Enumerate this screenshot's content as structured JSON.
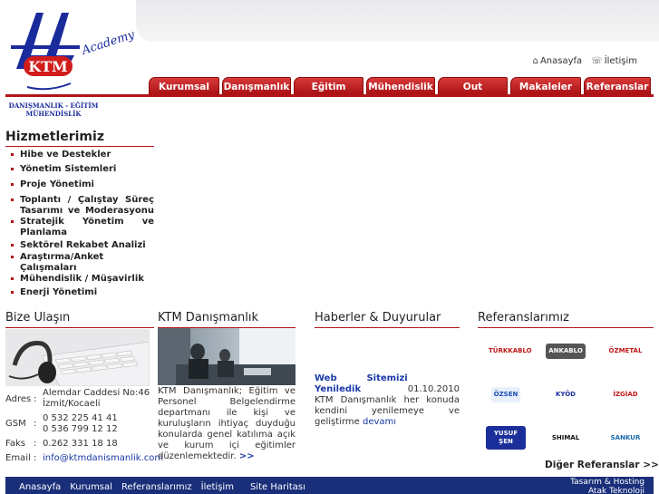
{
  "brand": {
    "letters": "KTM",
    "academy": "Academy",
    "subtitle_line1": "DANIŞMANLIK - EĞİTİM",
    "subtitle_line2": "MÜHENDİSLİK"
  },
  "toplinks": {
    "home": "Anasayfa",
    "contact": "İletişim"
  },
  "nav": [
    {
      "label": "Kurumsal",
      "w": 78
    },
    {
      "label": "Danışmanlık",
      "w": 76
    },
    {
      "label": "Eğitim",
      "w": 77
    },
    {
      "label": "Mühendislik",
      "w": 76
    },
    {
      "label": "Out Sourcing",
      "w": 77
    },
    {
      "label": "Makaleler",
      "w": 78
    },
    {
      "label": "Referanslar",
      "w": 74
    }
  ],
  "services": {
    "title": "Hizmetlerimiz",
    "items": [
      "Hibe ve Destekler",
      "Yönetim Sistemleri",
      "Proje Yönetimi",
      "Toplantı / Çalıştay Süreç Tasarımı ve Moderasyonu",
      "Stratejik Yönetim ve Planlama",
      "Sektörel Rekabet Analizi",
      "Araştırma/Anket Çalışmaları",
      "Mühendislik / Müşavirlik",
      "Enerji Yönetimi"
    ]
  },
  "contact": {
    "title": "Bize Ulaşın",
    "address_label": "Adres",
    "address": "Alemdar Caddesi No:46 İzmit/Kocaeli",
    "gsm_label": "GSM",
    "gsm1": "0 532 225 41 41",
    "gsm2": "0 536 799 12 12",
    "fax_label": "Faks",
    "fax": "0.262 331 18 18",
    "email_label": "Email",
    "email": "info@ktmdanismanlik.com"
  },
  "about": {
    "title": "KTM Danışmanlık",
    "text": "KTM Danışmanlık; Eğitim ve Personel Belgelendirme departmanı ile kişi ve kuruluşların ihtiyaç duyduğu konularda genel katılıma açık ve kurum içi eğitimler düzenlemektedir.",
    "more": ">>"
  },
  "news": {
    "title": "Haberler & Duyurular",
    "item_title": "Web Sitemizi Yeniledik",
    "item_date": "01.10.2010",
    "item_body": "KTM Danışmanlık her konuda kendini yenilemeye ve geliştirme",
    "item_more": "devamı"
  },
  "references": {
    "title": "Referanslarımız",
    "logos": [
      "TÜRKKABLO",
      "ANKABLO",
      "ÖZMETAL",
      "ÖZSEN",
      "KYÖD",
      "İZGİAD",
      "YUSUF ŞEN",
      "SHIMAL",
      "SANKUR"
    ],
    "more": "Diğer Referanslar >>"
  },
  "footer": {
    "links": [
      "Anasayfa",
      "Kurumsal",
      "Referanslarımız",
      "İletişim",
      "Site Haritası"
    ],
    "credit1": "Tasarım & Hosting",
    "credit2": "Atak Teknoloji"
  },
  "colors": {
    "accent": "#b21518",
    "navy": "#1a2f7a",
    "link": "#1a3aa8"
  }
}
